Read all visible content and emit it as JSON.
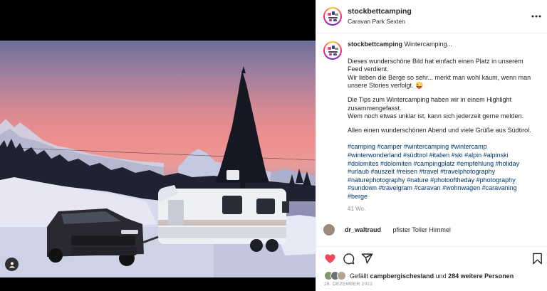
{
  "post": {
    "username": "stockbettcamping",
    "location": "Caravan Park Sexten"
  },
  "caption": {
    "username": "stockbettcamping",
    "title": "Wintercamping...",
    "paragraph1": "Dieses wunderschöne Bild hat einfach einen Platz in unserem Feed verdient.\nWir lieben die Berge so sehr... merkt man wohl kaum, wenn man unsere Stories verfolgt. 😜",
    "paragraph2": "Die Tips zum Wintercamping haben wir in einem Highlight zusammengefasst.\nWem noch etwas unklar ist, kann sich jederzeit gerne melden.",
    "paragraph3": "Allen einen wunderschönen Abend und viele Grüße aus Südtirol.",
    "hashtags": "#camping #camper #wintercamping #wintercamp #winterwonderland #südtirol #italien #ski #alpin #alpinski #dolomites #dolomiten #campingplatz #empfehlung #holiday #urlaub #auszeit #reisen #travel #travelphotography #naturephotography #nature #photooftheday #photography #sundown #travelgram #caravan #wohnwagen #caravaning #berge",
    "time_ago": "41 Wo."
  },
  "next_comment": {
    "username": "dr_waltraud",
    "text": "pfister Toller Himmel"
  },
  "likes": {
    "prefix": "Gefällt",
    "user": "campbergischesland",
    "connector": "und",
    "others": "284 weitere Personen"
  },
  "date": "28. DEZEMBER 2022",
  "colors": {
    "like_red": "#ed4956",
    "hashtag_blue": "#00376b",
    "muted_gray": "#8e8e8e"
  },
  "icons": [
    "user-tag-icon",
    "more-options-icon",
    "heart-icon",
    "comment-icon",
    "share-icon",
    "bookmark-icon"
  ]
}
